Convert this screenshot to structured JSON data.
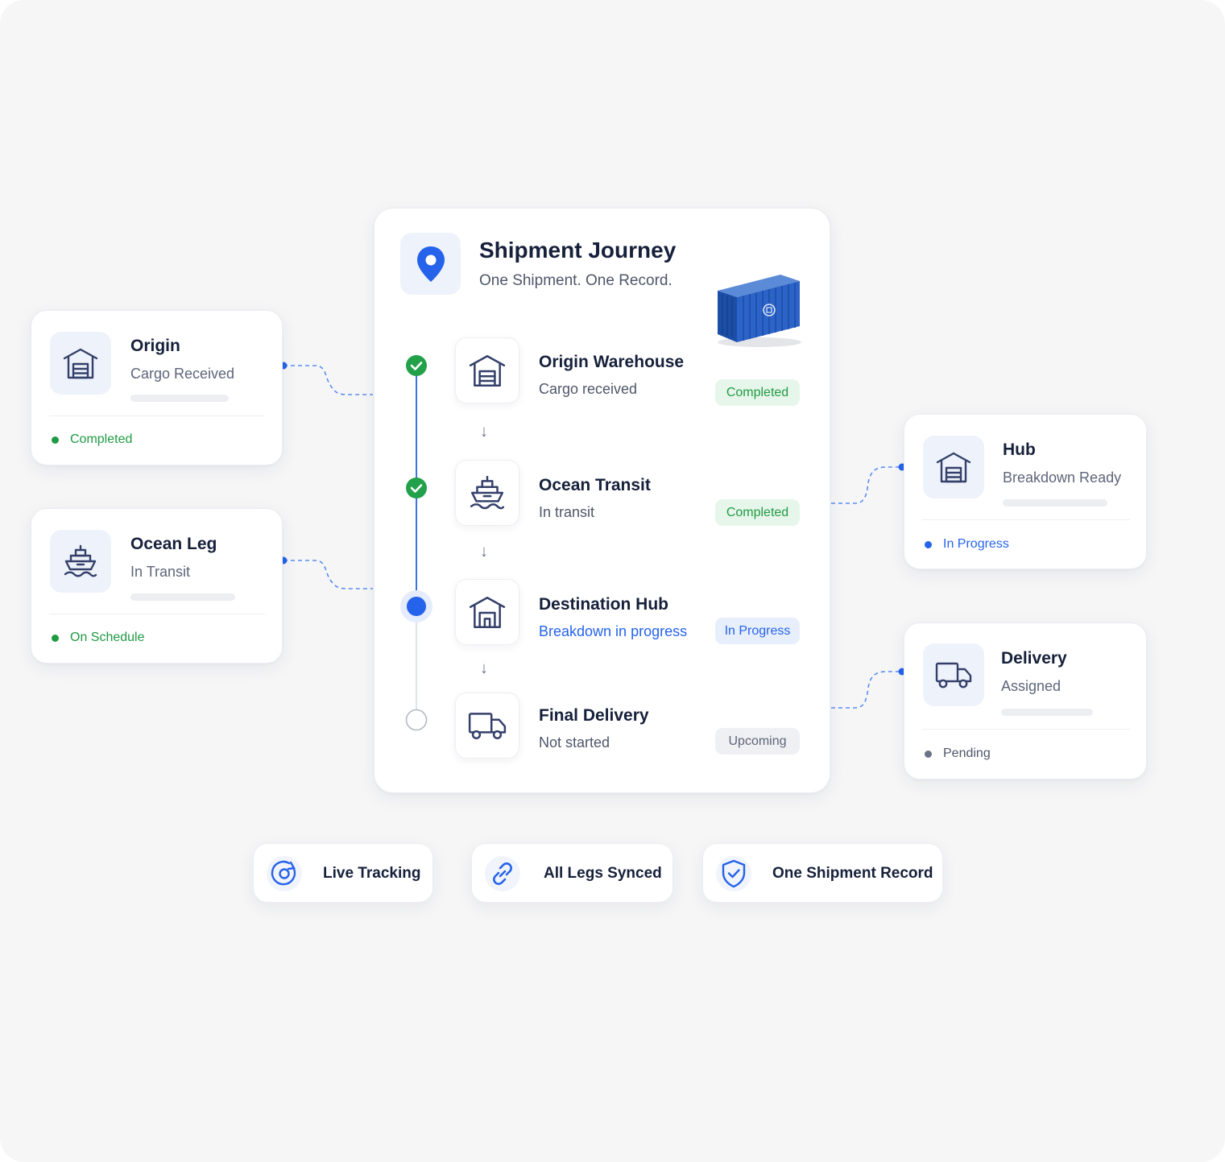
{
  "main": {
    "title": "Shipment Journey",
    "subtitle": "One Shipment. One Record.",
    "steps": [
      {
        "title": "Origin Warehouse",
        "sub": "Cargo received",
        "badge": "Completed",
        "state": "completed",
        "icon": "warehouse-icon"
      },
      {
        "title": "Ocean Transit",
        "sub": "In transit",
        "badge": "Completed",
        "state": "completed",
        "icon": "ship-icon"
      },
      {
        "title": "Destination Hub",
        "sub": "Breakdown in progress",
        "badge": "In Progress",
        "state": "in-progress",
        "icon": "warehouse-icon"
      },
      {
        "title": "Final Delivery",
        "sub": "Not started",
        "badge": "Upcoming",
        "state": "upcoming",
        "icon": "truck-icon"
      }
    ]
  },
  "side_cards": {
    "origin": {
      "title": "Origin",
      "sub": "Cargo Received",
      "status": "Completed",
      "status_color": "#1f9a43",
      "icon": "warehouse-icon"
    },
    "ocean": {
      "title": "Ocean Leg",
      "sub": "In Transit",
      "status": "On Schedule",
      "status_color": "#1f9a43",
      "icon": "ship-icon"
    },
    "hub": {
      "title": "Hub",
      "sub": "Breakdown Ready",
      "status": "In Progress",
      "status_color": "#2563eb",
      "icon": "warehouse-icon"
    },
    "delivery": {
      "title": "Delivery",
      "sub": "Assigned",
      "status": "Pending",
      "status_color": "#6b7284",
      "icon": "truck-icon"
    }
  },
  "features": [
    {
      "label": "Live Tracking",
      "icon": "target-icon"
    },
    {
      "label": "All Legs Synced",
      "icon": "link-icon"
    },
    {
      "label": "One Shipment Record",
      "icon": "shield-check-icon"
    }
  ],
  "colors": {
    "accent": "#2563eb",
    "success": "#1f9a43",
    "navy": "#16203a",
    "icon_stroke": "#34406a"
  }
}
